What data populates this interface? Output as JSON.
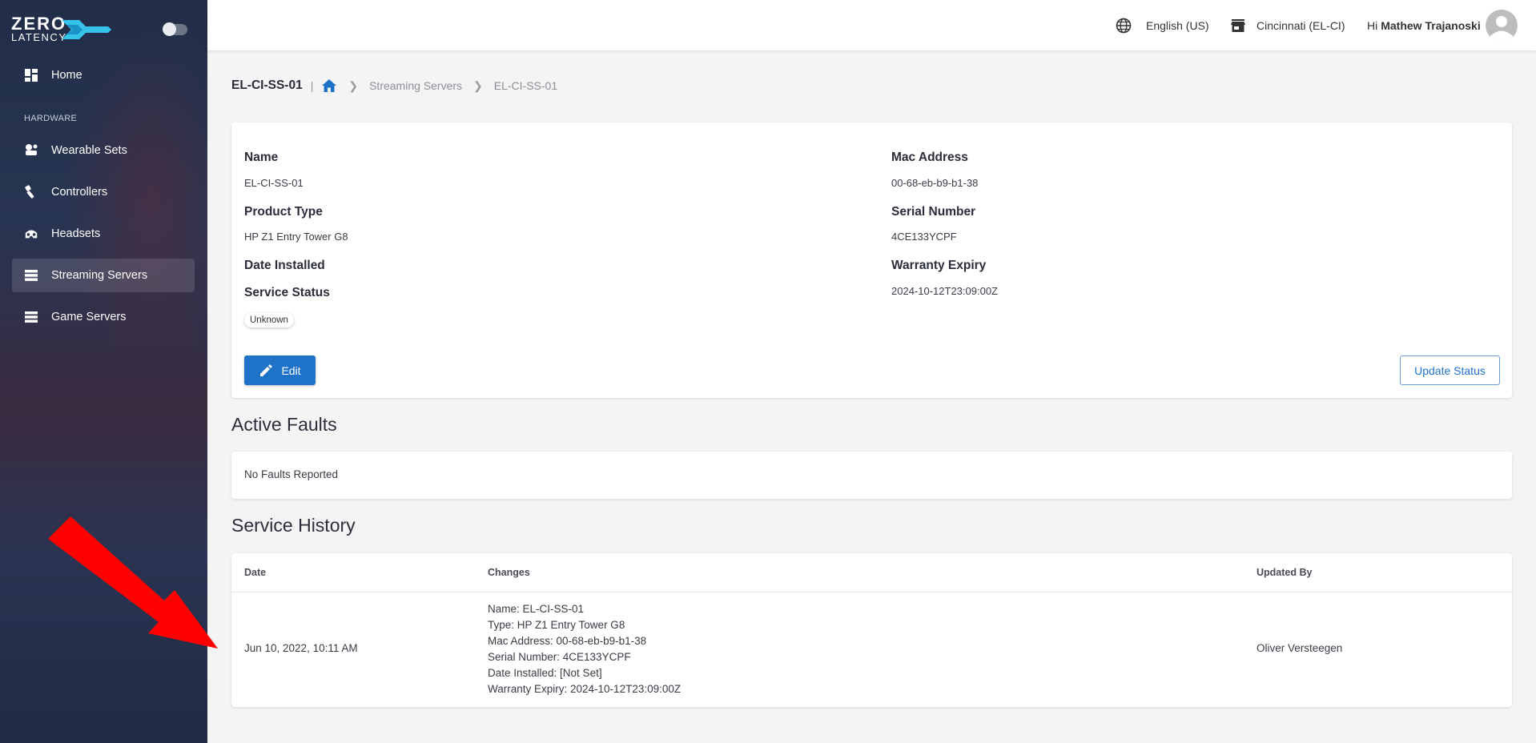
{
  "sidebar": {
    "logo": {
      "line1": "ZERO",
      "line2": "LATENCY"
    },
    "section_label": "HARDWARE",
    "items": [
      {
        "label": "Home",
        "icon": "dashboard-icon"
      },
      {
        "label": "Wearable Sets",
        "icon": "wearable-icon"
      },
      {
        "label": "Controllers",
        "icon": "controller-icon"
      },
      {
        "label": "Headsets",
        "icon": "headset-icon"
      },
      {
        "label": "Streaming Servers",
        "icon": "server-icon",
        "active": true
      },
      {
        "label": "Game Servers",
        "icon": "server-icon"
      }
    ]
  },
  "topbar": {
    "language": "English (US)",
    "location": "Cincinnati (EL-CI)",
    "greeting": "Hi",
    "user_name": "Mathew Trajanoski"
  },
  "breadcrumb": {
    "title": "EL-CI-SS-01",
    "separator": "|",
    "items": [
      "Streaming Servers",
      "EL-CI-SS-01"
    ]
  },
  "details": {
    "left": [
      {
        "label": "Name",
        "value": "EL-CI-SS-01"
      },
      {
        "label": "Product Type",
        "value": "HP Z1 Entry Tower G8"
      },
      {
        "label": "Date Installed",
        "value": ""
      },
      {
        "label": "Service Status",
        "value": ""
      }
    ],
    "right": [
      {
        "label": "Mac Address",
        "value": "00-68-eb-b9-b1-38"
      },
      {
        "label": "Serial Number",
        "value": "4CE133YCPF"
      },
      {
        "label": "Warranty Expiry",
        "value": "2024-10-12T23:09:00Z"
      }
    ],
    "status_chip": "Unknown",
    "edit_label": "Edit",
    "update_label": "Update Status"
  },
  "faults": {
    "title": "Active Faults",
    "empty_text": "No Faults Reported"
  },
  "history": {
    "title": "Service History",
    "columns": [
      "Date",
      "Changes",
      "Updated By"
    ],
    "rows": [
      {
        "date": "Jun 10, 2022, 10:11 AM",
        "changes": [
          "Name: EL-CI-SS-01",
          "Type: HP Z1 Entry Tower G8",
          "Mac Address: 00-68-eb-b9-b1-38",
          "Serial Number: 4CE133YCPF",
          "Date Installed: [Not Set]",
          "Warranty Expiry: 2024-10-12T23:09:00Z"
        ],
        "updated_by": "Oliver Versteegen"
      }
    ]
  },
  "colors": {
    "primary": "#1e73c9",
    "sidebar": "#222e48",
    "annotation_arrow": "#ff0000"
  }
}
